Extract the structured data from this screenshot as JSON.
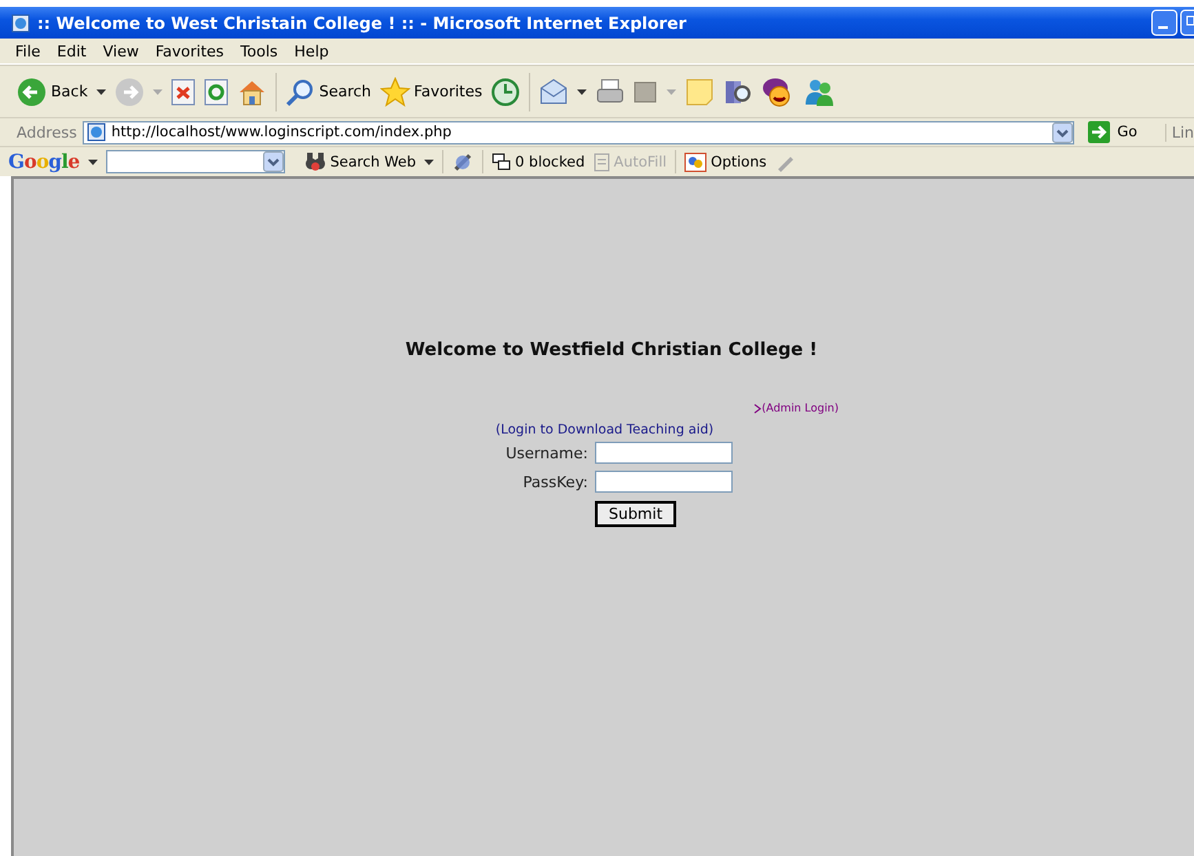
{
  "window": {
    "title": ":: Welcome to West Christain College ! :: - Microsoft Internet Explorer"
  },
  "menu": [
    "File",
    "Edit",
    "View",
    "Favorites",
    "Tools",
    "Help"
  ],
  "toolbar": {
    "back": "Back",
    "search": "Search",
    "favorites": "Favorites"
  },
  "address_bar": {
    "label": "Address",
    "value": "http://localhost/www.loginscript.com/index.php",
    "go": "Go",
    "links": "Lin"
  },
  "google_bar": {
    "logo": "Google",
    "search_web": "Search Web",
    "blocked": "0 blocked",
    "autofill": {
      "label": "AutoFill",
      "disabled": true
    },
    "options": "Options"
  },
  "page": {
    "heading": "Welcome to Westfield Christian College !",
    "admin_link": "(Admin Login)",
    "teaching_link": "(Login to Download Teaching aid)",
    "fields": [
      {
        "label": "Username:"
      },
      {
        "label": "PassKey:"
      }
    ],
    "submit": "Submit"
  }
}
